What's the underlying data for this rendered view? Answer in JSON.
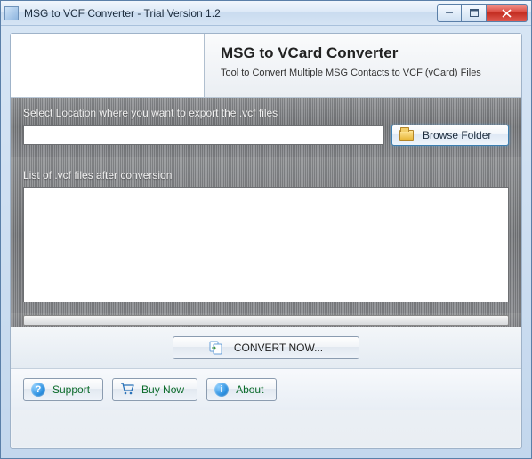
{
  "window": {
    "title": "MSG to VCF Converter - Trial Version 1.2"
  },
  "header": {
    "title": "MSG to VCard Converter",
    "subtitle": "Tool to Convert Multiple MSG Contacts to VCF (vCard) Files"
  },
  "export": {
    "label": "Select Location where you want to export the .vcf files",
    "path_value": "",
    "browse_label": "Browse Folder"
  },
  "list": {
    "label": "List of .vcf files after conversion"
  },
  "actions": {
    "convert_label": "CONVERT NOW..."
  },
  "footer": {
    "support_label": "Support",
    "buy_label": "Buy Now",
    "about_label": "About"
  },
  "icons": {
    "support_glyph": "?",
    "about_glyph": "i"
  }
}
